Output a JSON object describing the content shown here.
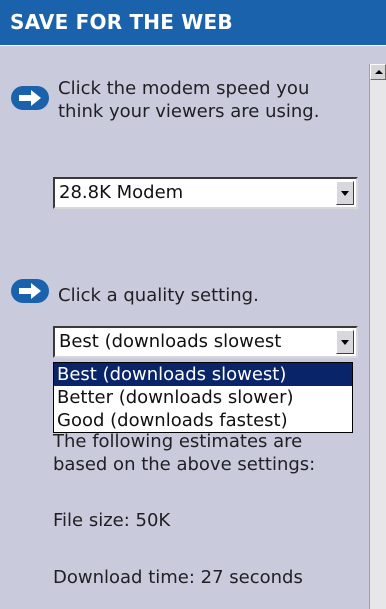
{
  "header": {
    "title": "SAVE FOR THE WEB"
  },
  "step1": {
    "icon": "right-arrow-icon",
    "instruction_line1": "Click the modem speed you",
    "instruction_line2": "think your viewers are using.",
    "modem_select": {
      "value": "28.8K Modem"
    }
  },
  "step2": {
    "icon": "right-arrow-icon",
    "instruction": "Click a quality setting.",
    "quality_select": {
      "value": "Best (downloads slowest",
      "options": [
        "Best (downloads slowest)",
        "Better (downloads slower)",
        "Good (downloads fastest)"
      ],
      "selected_index": 0
    }
  },
  "estimates": {
    "line1": "The following estimates are",
    "line2": "based on the above settings:",
    "file_size": "File size:  50K",
    "download_time": "Download time: 27 seconds"
  },
  "colors": {
    "header_bg": "#1b62ad",
    "panel_bg": "#c9cbdc",
    "selection_bg": "#0a246a"
  }
}
